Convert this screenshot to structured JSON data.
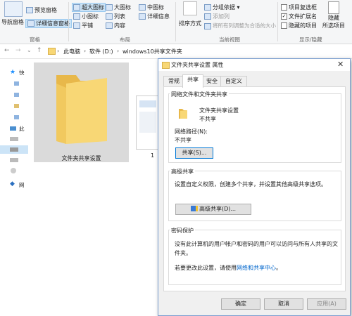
{
  "ribbon": {
    "nav_pane": "导航窗格",
    "preview_pane": "预览窗格",
    "details_pane": "详细信息窗格",
    "group_panes": "窗格",
    "layout": {
      "xlarge_icons": "超大图标",
      "large_icons": "大图标",
      "medium_icons": "中图标",
      "small_icons": "小图标",
      "list": "列表",
      "details": "详细信息",
      "tiles": "平铺",
      "content": "内容"
    },
    "group_layout": "布局",
    "sort_by": "排序方式",
    "group_by": "分组依据",
    "add_column": "添加列",
    "fit_columns": "将所有列调整为合适的大小",
    "group_current_view": "当前视图",
    "item_checkboxes": "项目复选框",
    "file_extensions": "文件扩展名",
    "hidden_items": "隐藏的项目",
    "hide": "隐藏",
    "selected_items": "所选项目",
    "group_show_hide": "显示/隐藏"
  },
  "address": {
    "crumbs": [
      "此电脑",
      "软件 (D:)",
      "windows10共享文件夹"
    ]
  },
  "nav": {
    "items": [
      "快",
      "此",
      "网"
    ]
  },
  "content": {
    "folder_name": "文件夹共享设置",
    "second_item_partial": "1"
  },
  "dialog": {
    "title": "文件夹共享设置 属性",
    "tabs": [
      "常规",
      "共享",
      "安全",
      "自定义"
    ],
    "net_section_title": "网络文件和文件夹共享",
    "folder_name": "文件夹共享设置",
    "share_status": "不共享",
    "net_path_label": "网络路径(N):",
    "net_path_value": "不共享",
    "share_button": "共享(S)...",
    "adv_section_title": "高级共享",
    "adv_desc": "设置自定义权限，创建多个共享，并设置其他高级共享选项。",
    "adv_button": "高级共享(D)...",
    "pwd_section_title": "密码保护",
    "pwd_desc": "没有此计算机的用户帐户和密码的用户可以访问与所有人共享的文件夹。",
    "pwd_change_prefix": "若要更改此设置，请使用",
    "pwd_link": "网络和共享中心",
    "pwd_change_suffix": "。",
    "ok_button": "确定",
    "cancel_button": "取消",
    "apply_button": "应用(A)"
  },
  "colors": {
    "accent": "#0078d7",
    "folder_yellow": "#f8d775",
    "title_bar": "#ffffff"
  }
}
